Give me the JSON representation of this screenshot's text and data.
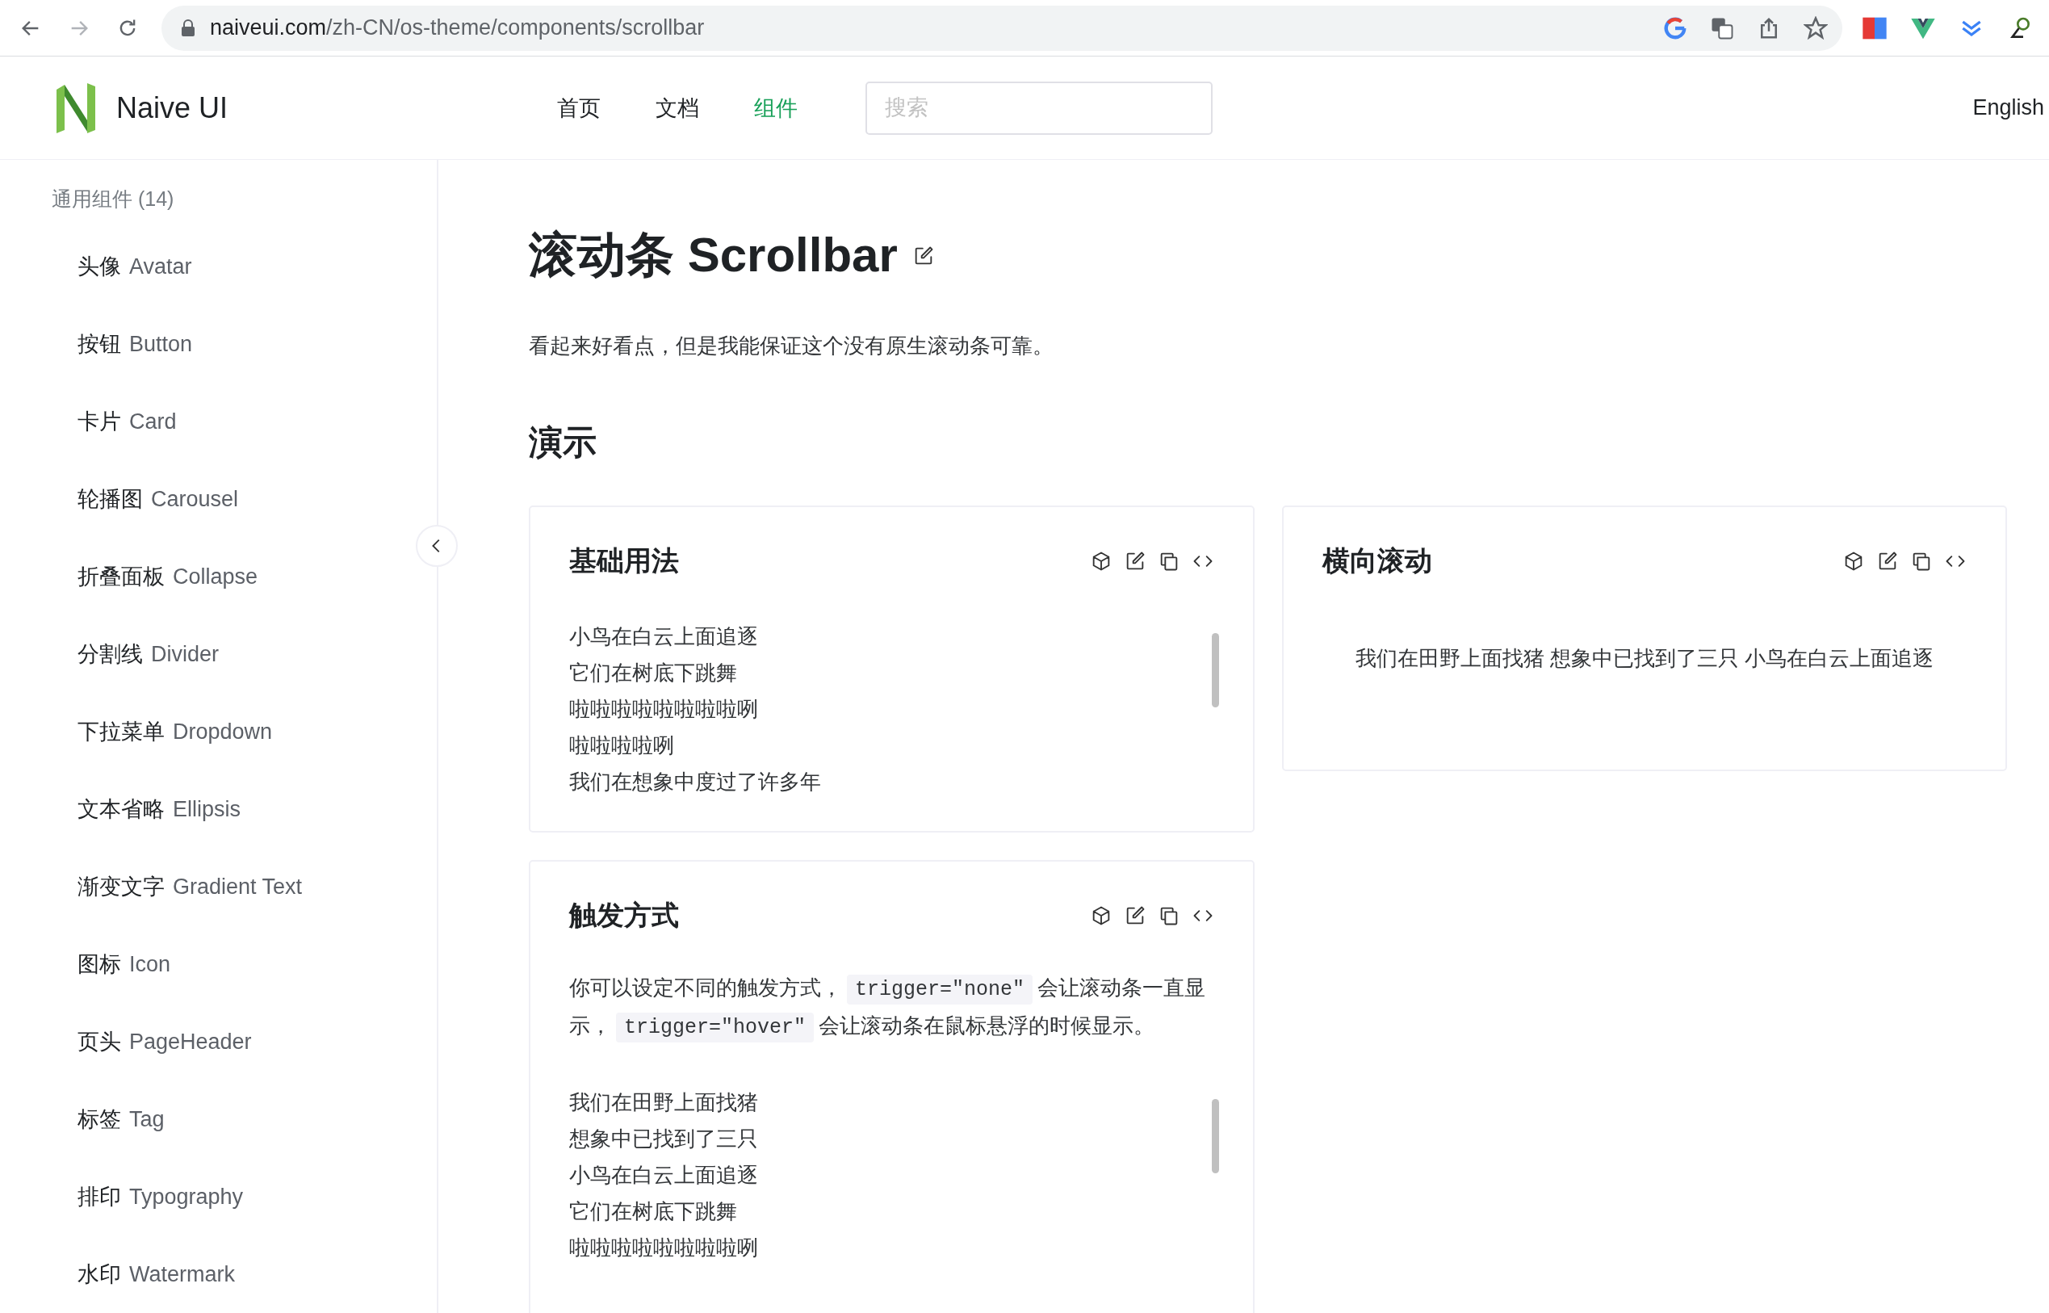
{
  "browser": {
    "url_host": "naiveui.com",
    "url_path": "/zh-CN/os-theme/components/scrollbar"
  },
  "header": {
    "logo_text": "Naive UI",
    "nav": [
      {
        "label": "首页",
        "selected": false
      },
      {
        "label": "文档",
        "selected": false
      },
      {
        "label": "组件",
        "selected": true
      }
    ],
    "search": {
      "placeholder": "搜索"
    },
    "language": "English"
  },
  "sidebar": {
    "group": "通用组件 (14)",
    "items": [
      {
        "zh": "头像",
        "en": "Avatar"
      },
      {
        "zh": "按钮",
        "en": "Button"
      },
      {
        "zh": "卡片",
        "en": "Card"
      },
      {
        "zh": "轮播图",
        "en": "Carousel"
      },
      {
        "zh": "折叠面板",
        "en": "Collapse"
      },
      {
        "zh": "分割线",
        "en": "Divider"
      },
      {
        "zh": "下拉菜单",
        "en": "Dropdown"
      },
      {
        "zh": "文本省略",
        "en": "Ellipsis"
      },
      {
        "zh": "渐变文字",
        "en": "Gradient Text"
      },
      {
        "zh": "图标",
        "en": "Icon"
      },
      {
        "zh": "页头",
        "en": "PageHeader"
      },
      {
        "zh": "标签",
        "en": "Tag"
      },
      {
        "zh": "排印",
        "en": "Typography"
      },
      {
        "zh": "水印",
        "en": "Watermark"
      }
    ]
  },
  "page": {
    "title": "滚动条 Scrollbar",
    "intro": "看起来好看点，但是我能保证这个没有原生滚动条可靠。",
    "section": "演示"
  },
  "demo_columns": [
    [
      {
        "kind": "vertical",
        "title": "基础用法",
        "lines": [
          "小鸟在白云上面追逐",
          "它们在树底下跳舞",
          "啦啦啦啦啦啦啦啦咧",
          "啦啦啦啦咧",
          "我们在想象中度过了许多年"
        ]
      },
      {
        "kind": "vertical",
        "title": "触发方式",
        "description": [
          {
            "text": "你可以设定不同的触发方式，"
          },
          {
            "code": "trigger=\"none\""
          },
          {
            "text": "会让滚动条一直显示，"
          },
          {
            "code": "trigger=\"hover\""
          },
          {
            "text": "会让滚动条在鼠标悬浮的时候显示。"
          }
        ],
        "lines": [
          "我们在田野上面找猪",
          "想象中已找到了三只",
          "小鸟在白云上面追逐",
          "它们在树底下跳舞",
          "啦啦啦啦啦啦啦啦咧"
        ]
      }
    ],
    [
      {
        "kind": "horizontal",
        "title": "横向滚动",
        "lines": [
          "我们在田野上面找猪 想象中已找到了三只 小鸟在白云上面追逐"
        ]
      }
    ]
  ]
}
